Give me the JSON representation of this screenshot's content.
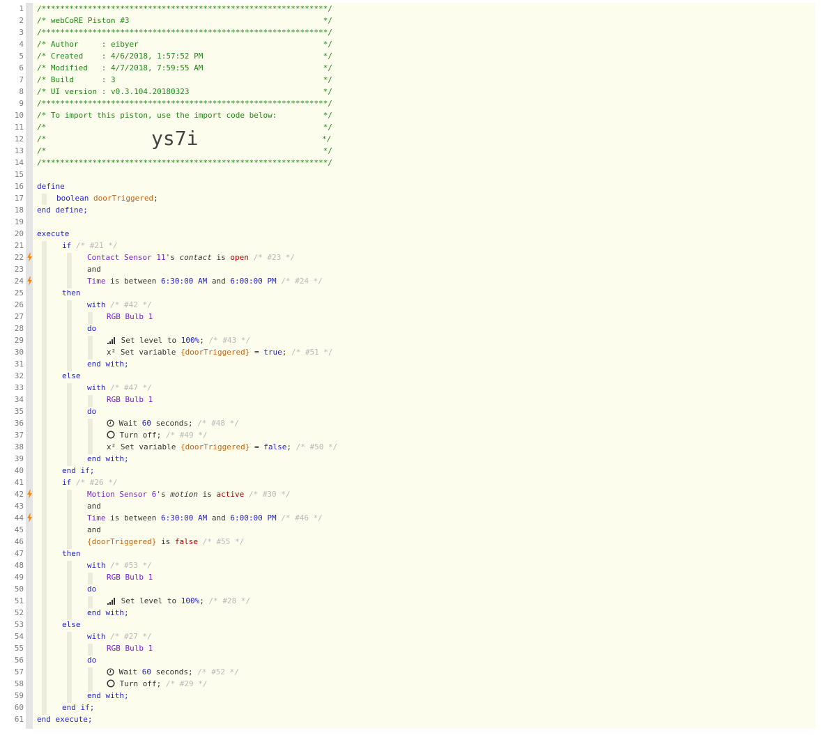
{
  "header": {
    "line1": "/**************************************************************/",
    "line2": "/* webCoRE Piston #3                                          */",
    "line3": "/**************************************************************/",
    "line4": "/* Author     : eibyer                                        */",
    "line5": "/* Created    : 4/6/2018, 1:57:52 PM                          */",
    "line6": "/* Modified   : 4/7/2018, 7:59:55 AM                          */",
    "line7": "/* Build      : 3                                             */",
    "line8": "/* UI version : v0.3.104.20180323                             */",
    "line9": "/**************************************************************/",
    "line10": "/* To import this piston, use the import code below:          */",
    "line11": "/*                                                            */",
    "line12_a": "/*",
    "import_code": "ys7i",
    "line12_b": "*/",
    "line13": "/*                                                            */",
    "line14": "/**************************************************************/"
  },
  "kw": {
    "define": "define",
    "boolean": "boolean",
    "end_define": "end define;",
    "execute": "execute",
    "end_execute": "end execute;",
    "if": "if",
    "and": "and",
    "then": "then",
    "else": "else",
    "end_if": "end if;",
    "with": "with",
    "do": "do",
    "end_with": "end with;",
    "is": "is",
    "is_between": "is between",
    "and_inline": "and",
    "set_level": "Set level to",
    "set_variable": "Set variable",
    "wait": "Wait",
    "seconds": "seconds;",
    "turn_off": "Turn off;",
    "eq": "=",
    "possessive": "'s"
  },
  "vars": {
    "doorTriggered": "doorTriggered",
    "doorTriggered_ref": "{doorTriggered}",
    "semicolon": ";"
  },
  "devices": {
    "contact_sensor": "Contact Sensor 11",
    "motion_sensor": "Motion Sensor 6",
    "time": "Time",
    "rgb_bulb": "RGB Bulb 1"
  },
  "attrs": {
    "contact": "contact",
    "motion": "motion"
  },
  "values": {
    "open": "open",
    "active": "active",
    "false": "false",
    "true": "true",
    "t_start": "6:30:00 AM",
    "t_end": "6:00:00 PM",
    "level": "100%",
    "wait_secs": "60"
  },
  "comments": {
    "c21": "/* #21 */",
    "c23": "/* #23 */",
    "c24": "/* #24 */",
    "c42": "/* #42 */",
    "c43": "/* #43 */",
    "c51": "/* #51 */",
    "c47": "/* #47 */",
    "c48": "/* #48 */",
    "c49": "/* #49 */",
    "c50": "/* #50 */",
    "c26": "/* #26 */",
    "c30": "/* #30 */",
    "c46": "/* #46 */",
    "c55": "/* #55 */",
    "c53": "/* #53 */",
    "c28": "/* #28 */",
    "c27": "/* #27 */",
    "c52": "/* #52 */",
    "c29": "/* #29 */"
  },
  "line_numbers": [
    "1",
    "2",
    "3",
    "4",
    "5",
    "6",
    "7",
    "8",
    "9",
    "10",
    "11",
    "12",
    "13",
    "14",
    "15",
    "16",
    "17",
    "18",
    "19",
    "20",
    "21",
    "22",
    "23",
    "24",
    "25",
    "26",
    "27",
    "28",
    "29",
    "30",
    "31",
    "32",
    "33",
    "34",
    "35",
    "36",
    "37",
    "38",
    "39",
    "40",
    "41",
    "42",
    "43",
    "44",
    "45",
    "46",
    "47",
    "48",
    "49",
    "50",
    "51",
    "52",
    "53",
    "54",
    "55",
    "56",
    "57",
    "58",
    "59",
    "60",
    "61"
  ],
  "colors": {
    "comment_green": "#1d8a14",
    "keyword_blue": "#2323c8",
    "device_purple": "#7a1fd4",
    "variable_orange": "#c86411",
    "value_red": "#b00000",
    "bolt_orange": "#f08a1c"
  }
}
